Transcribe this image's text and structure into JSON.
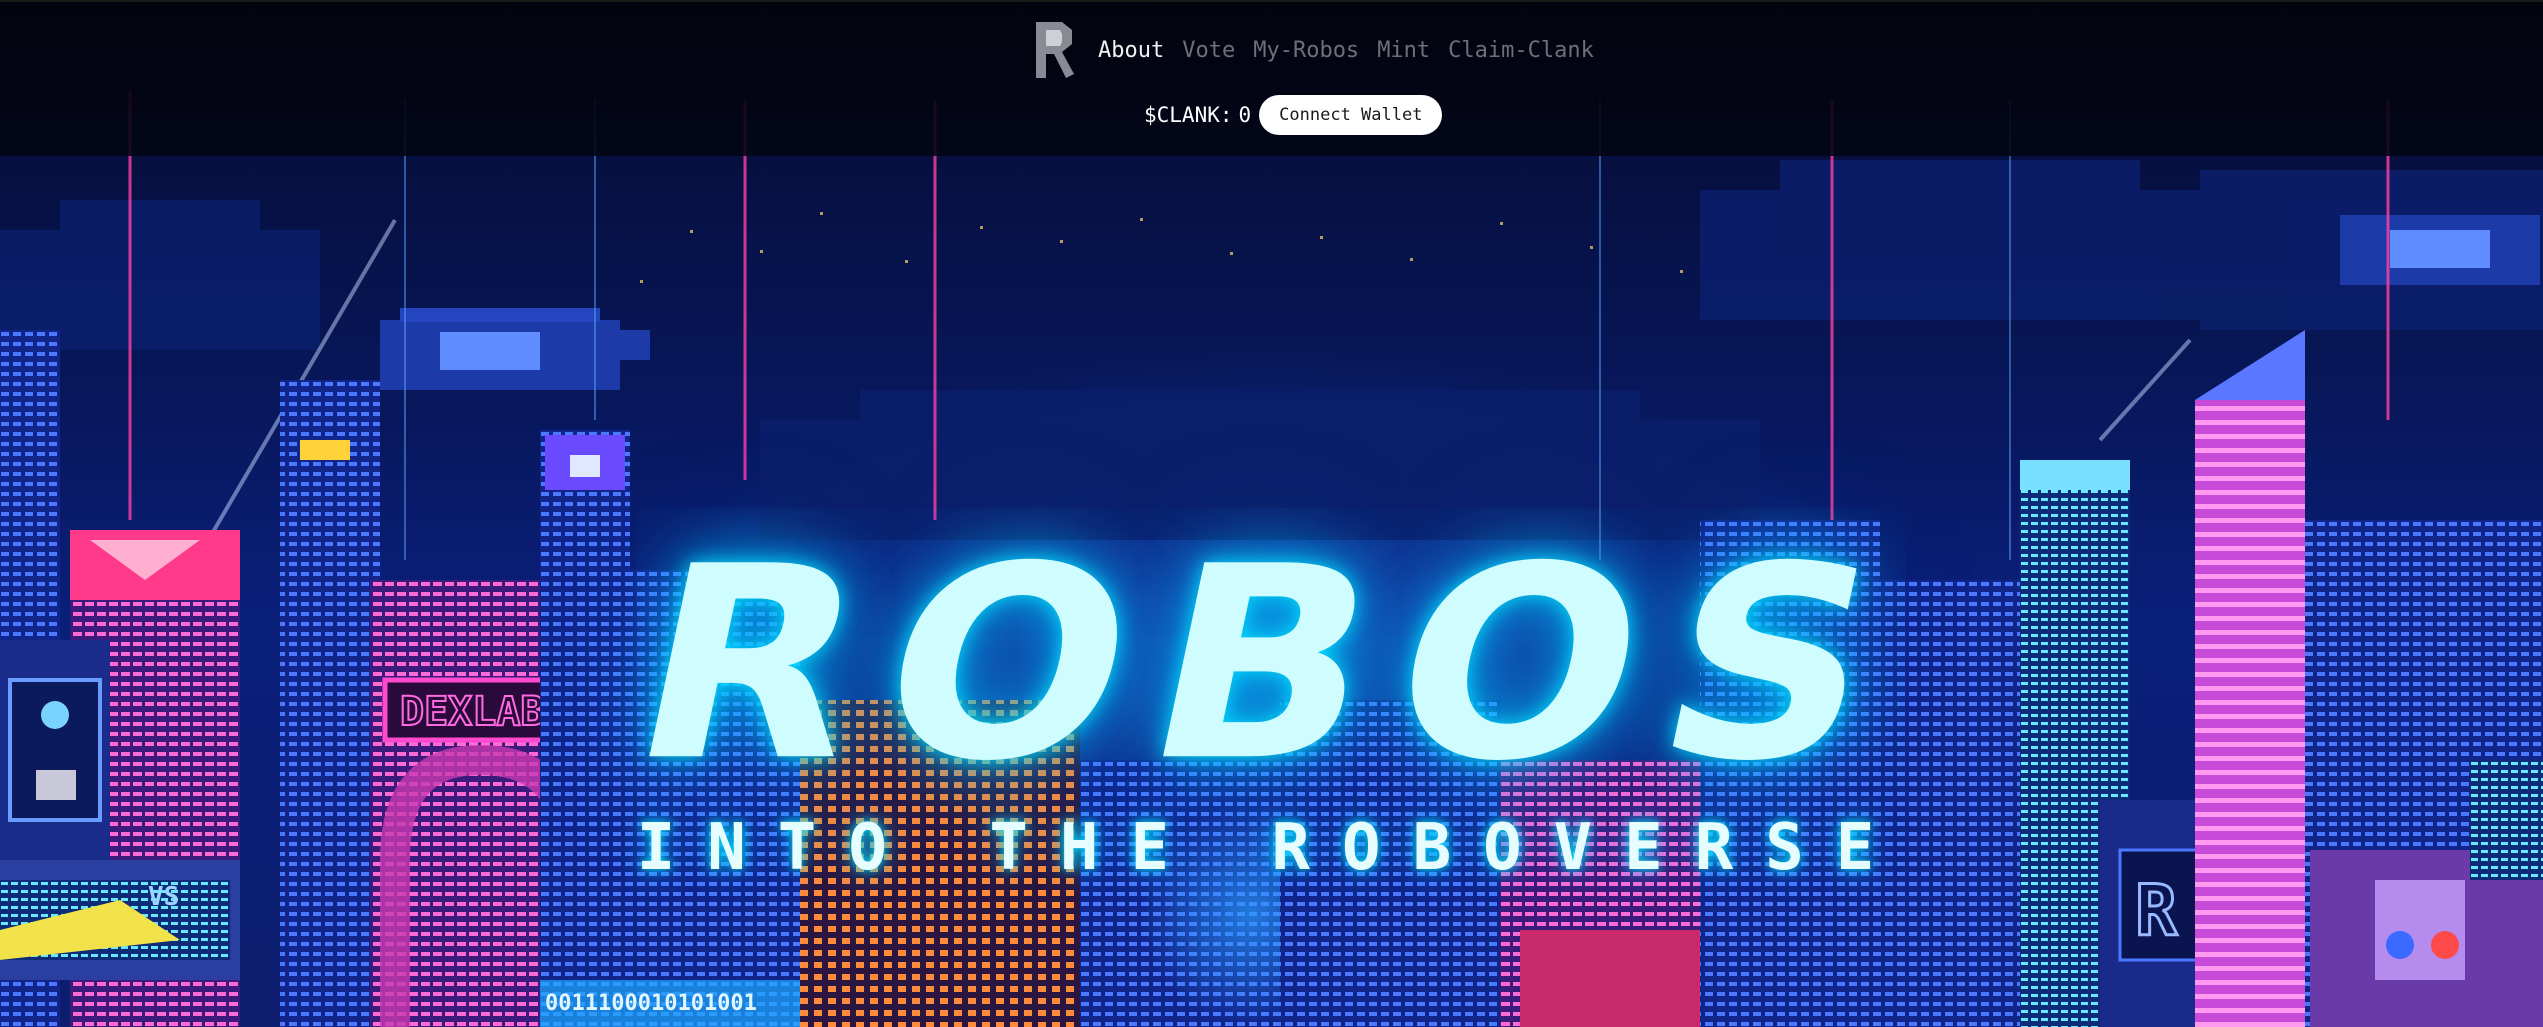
{
  "header": {
    "logo_icon": "robos-r-logo-icon",
    "nav": [
      {
        "label": "About",
        "active": true
      },
      {
        "label": "Vote",
        "active": false
      },
      {
        "label": "My-Robos",
        "active": false
      },
      {
        "label": "Mint",
        "active": false
      },
      {
        "label": "Claim-Clank",
        "active": false
      }
    ],
    "wallet": {
      "clank_label": "$CLANK:",
      "clank_value": "0",
      "connect_label": "Connect Wallet"
    }
  },
  "hero": {
    "title": "ROBOS",
    "subtitle": "INTO THE ROBOVERSE",
    "signs": {
      "dexlab": "DEXLAB",
      "vs": "VS",
      "r_sign": "R",
      "binary": "0011100010101001"
    }
  },
  "colors": {
    "header_bg": "#03040f",
    "nav_active": "#f2f2f2",
    "nav_inactive": "#6f6f7a",
    "title_glow": "#00e6ff",
    "sky_top": "#040a2e",
    "neon_pink": "#ff3fa4"
  }
}
